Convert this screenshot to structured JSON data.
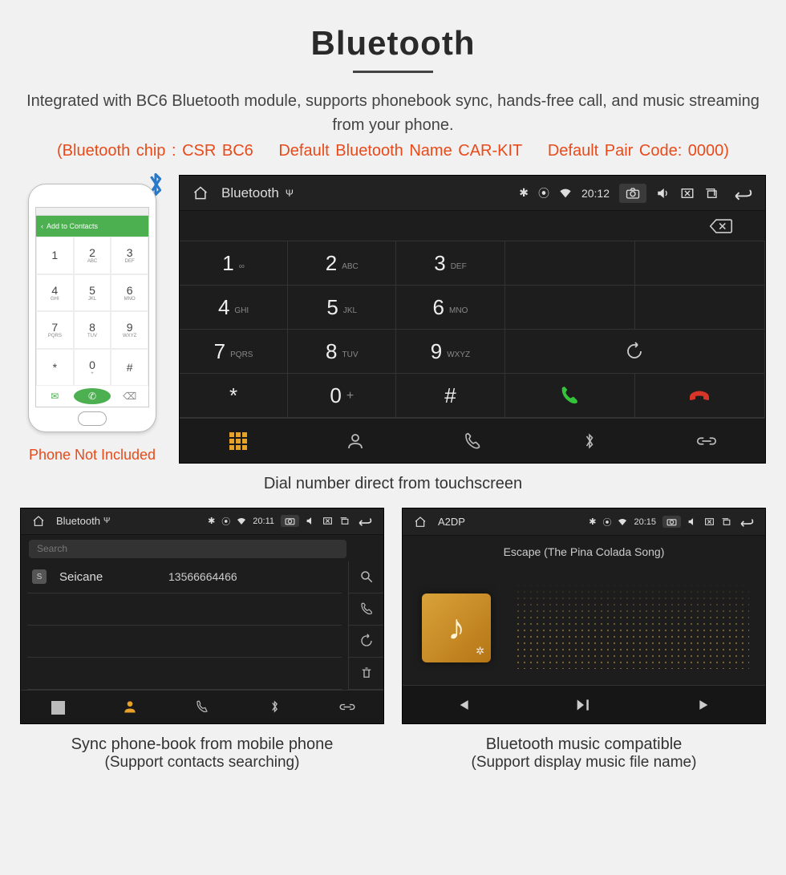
{
  "header": {
    "title": "Bluetooth",
    "description": "Integrated with BC6 Bluetooth module, supports phonebook sync, hands-free call, and music streaming from your phone.",
    "spec_chip": "(Bluetooth chip : CSR BC6",
    "spec_name": "Default Bluetooth Name CAR-KIT",
    "spec_code": "Default Pair Code: 0000)"
  },
  "phone_mock": {
    "header_label": "Add to Contacts",
    "keys": [
      {
        "n": "1",
        "s": ""
      },
      {
        "n": "2",
        "s": "ABC"
      },
      {
        "n": "3",
        "s": "DEF"
      },
      {
        "n": "4",
        "s": "GHI"
      },
      {
        "n": "5",
        "s": "JKL"
      },
      {
        "n": "6",
        "s": "MNO"
      },
      {
        "n": "7",
        "s": "PQRS"
      },
      {
        "n": "8",
        "s": "TUV"
      },
      {
        "n": "9",
        "s": "WXYZ"
      },
      {
        "n": "*",
        "s": ""
      },
      {
        "n": "0",
        "s": "+"
      },
      {
        "n": "#",
        "s": ""
      }
    ],
    "note": "Phone Not Included"
  },
  "dialer": {
    "title": "Bluetooth",
    "time": "20:12",
    "keys": [
      {
        "n": "1",
        "s": "∞"
      },
      {
        "n": "2",
        "s": "ABC"
      },
      {
        "n": "3",
        "s": "DEF"
      },
      {
        "n": "4",
        "s": "GHI"
      },
      {
        "n": "5",
        "s": "JKL"
      },
      {
        "n": "6",
        "s": "MNO"
      },
      {
        "n": "7",
        "s": "PQRS"
      },
      {
        "n": "8",
        "s": "TUV"
      },
      {
        "n": "9",
        "s": "WXYZ"
      },
      {
        "n": "*",
        "s": ""
      },
      {
        "n": "0",
        "s": "+"
      },
      {
        "n": "#",
        "s": ""
      }
    ],
    "caption": "Dial number direct from touchscreen"
  },
  "phonebook": {
    "title": "Bluetooth",
    "time": "20:11",
    "search_placeholder": "Search",
    "contacts": [
      {
        "tag": "S",
        "name": "Seicane",
        "number": "13566664466"
      }
    ],
    "caption_line1": "Sync phone-book from mobile phone",
    "caption_line2": "(Support contacts searching)"
  },
  "a2dp": {
    "title": "A2DP",
    "time": "20:15",
    "track": "Escape (The Pina Colada Song)",
    "caption_line1": "Bluetooth music compatible",
    "caption_line2": "(Support display music file name)"
  }
}
